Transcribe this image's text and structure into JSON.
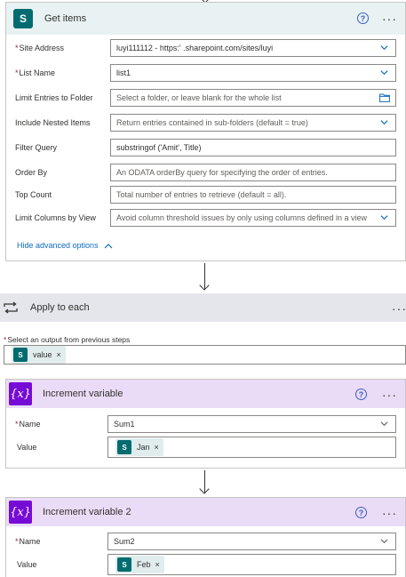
{
  "get_items": {
    "title": "Get items",
    "help": "?",
    "more": "···",
    "fields": [
      {
        "label": "Site Address",
        "required": true,
        "value": "luyi111112 - https:'                      .sharepoint.com/sites/luyi",
        "placeholder": false,
        "control": "dropdown"
      },
      {
        "label": "List Name",
        "required": true,
        "value": "list1",
        "placeholder": false,
        "control": "dropdown"
      },
      {
        "label": "Limit Entries to Folder",
        "required": false,
        "value": "Select a folder, or leave blank for the whole list",
        "placeholder": true,
        "control": "folder"
      },
      {
        "label": "Include Nested Items",
        "required": false,
        "value": "Return entries contained in sub-folders (default = true)",
        "placeholder": true,
        "control": "dropdown"
      },
      {
        "label": "Filter Query",
        "required": false,
        "value": "substringof  ('Amit', Title)",
        "placeholder": false,
        "control": "text"
      },
      {
        "label": "Order By",
        "required": false,
        "value": "An ODATA orderBy query for specifying the order of entries.",
        "placeholder": true,
        "control": "text"
      },
      {
        "label": "Top Count",
        "required": false,
        "value": "Total number of entries to retrieve (default = all).",
        "placeholder": true,
        "control": "text"
      },
      {
        "label": "Limit Columns by View",
        "required": false,
        "value": "Avoid column threshold issues by only using columns defined in a view",
        "placeholder": true,
        "control": "dropdown"
      }
    ],
    "hide_advanced": "Hide advanced options"
  },
  "apply_to_each": {
    "title": "Apply to each",
    "more": "···",
    "select_label": "Select an output from previous steps",
    "token_label": "value",
    "token_remove": "×"
  },
  "increment_1": {
    "title": "Increment variable",
    "help": "?",
    "more": "···",
    "name_label": "Name",
    "name_value": "Sum1",
    "value_label": "Value",
    "token_label": "Jan",
    "token_remove": "×"
  },
  "increment_2": {
    "title": "Increment variable 2",
    "help": "?",
    "more": "···",
    "name_label": "Name",
    "name_value": "Sum2",
    "value_label": "Value",
    "token_label": "Feb",
    "token_remove": "×"
  },
  "icons": {
    "sharepoint": "S",
    "variable": "{x}",
    "required": "*"
  },
  "colors": {
    "sharepoint_header": "#e9f2f2",
    "apply_header": "#e4e6eb",
    "variable_header": "#eadcf6",
    "sharepoint_brand": "#036c70",
    "variable_brand": "#770bd6",
    "link": "#0f6cbd",
    "required": "#a4262c"
  }
}
